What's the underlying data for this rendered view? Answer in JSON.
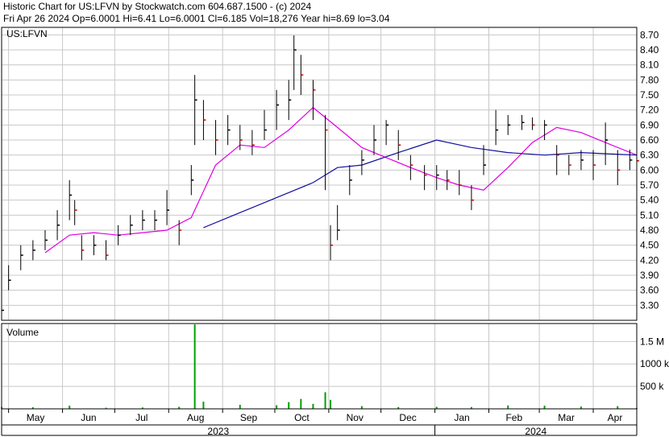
{
  "header": {
    "line1": "Historic Chart for US:LFVN by Stockwatch.com 604.687.1500 - (c) 2024",
    "line2": "Fri Apr 26 2024  Op=6.0001  Hi=6.41  Lo=6.0001  Cl=6.185  Vol=18,276  Year hi=8.69  lo=3.04"
  },
  "colors": {
    "price_up": "#000000",
    "price_down": "#cc0000",
    "ma_short": "#e000e0",
    "ma_long": "#1010a0",
    "volume": "#00a000",
    "grid": "#c8c8c8"
  },
  "chart_data": {
    "type": "line",
    "symbol": "US:LFVN",
    "price_axis": {
      "ylim": [
        3.0,
        8.85
      ],
      "ticks": [
        "8.70",
        "8.40",
        "8.10",
        "7.80",
        "7.50",
        "7.20",
        "6.90",
        "6.60",
        "6.30",
        "6.00",
        "5.70",
        "5.40",
        "5.10",
        "4.80",
        "4.50",
        "4.20",
        "3.90",
        "3.60",
        "3.30"
      ]
    },
    "volume_axis": {
      "label": "Volume",
      "ticks": [
        "1.5 M",
        "1000 k",
        "500 k"
      ],
      "ylim": [
        0,
        1900000
      ]
    },
    "x_axis": {
      "months": [
        "May",
        "Jun",
        "Jul",
        "Aug",
        "Sep",
        "Oct",
        "Nov",
        "Dec",
        "Jan",
        "Feb",
        "Mar",
        "Apr"
      ],
      "years": [
        "2023",
        "2024"
      ],
      "start": "2023-04-27",
      "end": "2024-04-26"
    },
    "price": {
      "dates": [
        "2023-04-27",
        "2023-05-01",
        "2023-05-08",
        "2023-05-15",
        "2023-05-22",
        "2023-05-29",
        "2023-06-05",
        "2023-06-08",
        "2023-06-12",
        "2023-06-19",
        "2023-06-26",
        "2023-07-03",
        "2023-07-10",
        "2023-07-17",
        "2023-07-24",
        "2023-07-31",
        "2023-08-07",
        "2023-08-14",
        "2023-08-16",
        "2023-08-21",
        "2023-08-28",
        "2023-09-04",
        "2023-09-11",
        "2023-09-18",
        "2023-09-25",
        "2023-10-02",
        "2023-10-09",
        "2023-10-12",
        "2023-10-16",
        "2023-10-23",
        "2023-10-30",
        "2023-11-02",
        "2023-11-06",
        "2023-11-13",
        "2023-11-20",
        "2023-11-27",
        "2023-12-04",
        "2023-12-11",
        "2023-12-18",
        "2023-12-26",
        "2024-01-02",
        "2024-01-08",
        "2024-01-15",
        "2024-01-22",
        "2024-01-29",
        "2024-02-05",
        "2024-02-12",
        "2024-02-20",
        "2024-02-26",
        "2024-03-04",
        "2024-03-11",
        "2024-03-18",
        "2024-03-25",
        "2024-04-01",
        "2024-04-08",
        "2024-04-15",
        "2024-04-22",
        "2024-04-26"
      ],
      "close": [
        3.2,
        3.8,
        4.3,
        4.4,
        4.6,
        4.9,
        5.5,
        5.2,
        4.4,
        4.5,
        4.3,
        4.7,
        4.9,
        5.0,
        5.0,
        5.2,
        4.8,
        5.8,
        7.4,
        7.0,
        6.6,
        6.8,
        6.6,
        6.5,
        6.8,
        7.3,
        7.4,
        8.4,
        7.9,
        7.6,
        6.8,
        4.5,
        4.8,
        5.8,
        6.2,
        6.6,
        6.9,
        6.5,
        6.1,
        5.9,
        5.9,
        5.8,
        5.7,
        5.4,
        6.1,
        6.8,
        6.9,
        6.95,
        6.9,
        6.9,
        6.3,
        6.1,
        6.2,
        6.1,
        6.6,
        6.0,
        6.2,
        6.185
      ],
      "high": [
        3.4,
        4.1,
        4.5,
        4.6,
        4.8,
        5.2,
        5.8,
        5.4,
        4.7,
        4.7,
        4.6,
        4.9,
        5.1,
        5.2,
        5.2,
        5.6,
        5.0,
        6.1,
        7.9,
        7.4,
        7.0,
        7.1,
        6.9,
        6.8,
        7.2,
        7.6,
        7.8,
        8.69,
        8.3,
        7.8,
        7.1,
        4.9,
        5.3,
        6.1,
        6.4,
        6.9,
        7.0,
        6.8,
        6.3,
        6.1,
        6.1,
        6.0,
        6.0,
        5.7,
        6.5,
        7.2,
        7.1,
        7.1,
        7.05,
        7.0,
        6.5,
        6.3,
        6.4,
        6.4,
        6.95,
        6.4,
        6.41,
        6.41
      ],
      "low": [
        3.04,
        3.6,
        4.0,
        4.2,
        4.4,
        4.6,
        5.0,
        4.9,
        4.2,
        4.3,
        4.2,
        4.5,
        4.7,
        4.8,
        4.8,
        4.9,
        4.5,
        5.5,
        6.5,
        6.6,
        6.3,
        6.5,
        6.4,
        6.3,
        6.6,
        6.8,
        7.0,
        7.6,
        7.5,
        7.0,
        5.6,
        4.2,
        4.6,
        5.5,
        5.9,
        6.3,
        6.5,
        6.2,
        5.8,
        5.6,
        5.6,
        5.6,
        5.5,
        5.2,
        5.9,
        6.5,
        6.7,
        6.8,
        6.8,
        6.6,
        5.9,
        5.9,
        6.0,
        5.8,
        6.1,
        5.7,
        6.0,
        6.0001
      ]
    },
    "ma_short": {
      "dates": [
        "2023-05-22",
        "2023-06-05",
        "2023-06-19",
        "2023-07-03",
        "2023-07-17",
        "2023-07-31",
        "2023-08-14",
        "2023-08-28",
        "2023-09-11",
        "2023-09-25",
        "2023-10-09",
        "2023-10-23",
        "2023-11-06",
        "2023-11-20",
        "2023-12-04",
        "2023-12-18",
        "2024-01-02",
        "2024-01-15",
        "2024-01-29",
        "2024-02-12",
        "2024-02-26",
        "2024-03-11",
        "2024-03-25",
        "2024-04-08",
        "2024-04-26"
      ],
      "values": [
        4.35,
        4.7,
        4.75,
        4.7,
        4.75,
        4.8,
        5.05,
        6.1,
        6.5,
        6.45,
        6.8,
        7.25,
        6.85,
        6.45,
        6.25,
        6.05,
        5.85,
        5.7,
        5.6,
        6.05,
        6.55,
        6.85,
        6.75,
        6.55,
        6.3
      ]
    },
    "ma_long": {
      "dates": [
        "2023-08-21",
        "2023-09-11",
        "2023-10-02",
        "2023-10-23",
        "2023-11-06",
        "2023-11-20",
        "2023-12-11",
        "2024-01-02",
        "2024-01-22",
        "2024-02-12",
        "2024-03-04",
        "2024-03-25",
        "2024-04-26"
      ],
      "values": [
        4.85,
        5.15,
        5.45,
        5.75,
        6.05,
        6.1,
        6.35,
        6.6,
        6.45,
        6.35,
        6.3,
        6.35,
        6.3
      ]
    },
    "volume": {
      "dates": [
        "2023-04-27",
        "2023-05-15",
        "2023-06-05",
        "2023-06-26",
        "2023-07-17",
        "2023-08-07",
        "2023-08-16",
        "2023-08-21",
        "2023-09-11",
        "2023-10-02",
        "2023-10-09",
        "2023-10-16",
        "2023-10-23",
        "2023-10-30",
        "2023-11-02",
        "2023-11-20",
        "2023-12-11",
        "2024-01-02",
        "2024-01-22",
        "2024-02-12",
        "2024-03-04",
        "2024-03-25",
        "2024-04-15",
        "2024-04-26"
      ],
      "values": [
        40000,
        35000,
        70000,
        25000,
        30000,
        45000,
        1880000,
        160000,
        90000,
        80000,
        150000,
        220000,
        110000,
        370000,
        200000,
        60000,
        40000,
        45000,
        40000,
        75000,
        70000,
        50000,
        60000,
        18276
      ]
    }
  }
}
